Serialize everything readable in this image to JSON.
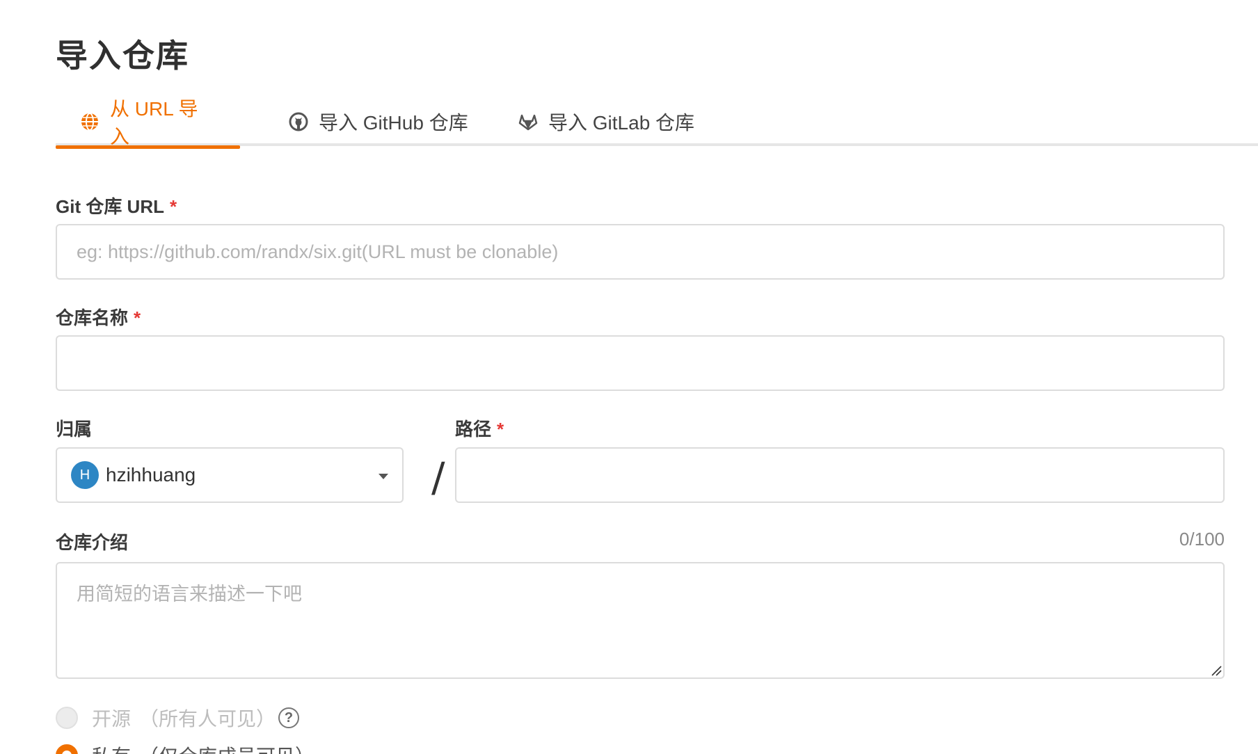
{
  "page": {
    "title": "导入仓库"
  },
  "tabs": [
    {
      "label": "从 URL 导入",
      "icon": "globe-icon",
      "active": true
    },
    {
      "label": "导入 GitHub 仓库",
      "icon": "github-icon",
      "active": false
    },
    {
      "label": "导入 GitLab 仓库",
      "icon": "gitlab-icon",
      "active": false
    }
  ],
  "colors": {
    "accent": "#f07000",
    "required": "#e53935",
    "avatar": "#2d86c4"
  },
  "form": {
    "git_url": {
      "label": "Git 仓库 URL",
      "required_mark": "*",
      "placeholder": "eg: https://github.com/randx/six.git(URL must be clonable)",
      "value": ""
    },
    "repo_name": {
      "label": "仓库名称",
      "required_mark": "*",
      "value": ""
    },
    "owner": {
      "label": "归属",
      "avatar_letter": "H",
      "value": "hzihhuang"
    },
    "separator": "/",
    "path": {
      "label": "路径",
      "required_mark": "*",
      "value": ""
    },
    "description": {
      "label": "仓库介绍",
      "counter": "0/100",
      "placeholder": "用简短的语言来描述一下吧",
      "value": ""
    },
    "visibility": [
      {
        "label": "开源",
        "note": "（所有人可见）",
        "selected": false,
        "disabled": true
      },
      {
        "label": "私有",
        "note": "（仅仓库成员可见）",
        "selected": true,
        "disabled": false
      }
    ]
  }
}
